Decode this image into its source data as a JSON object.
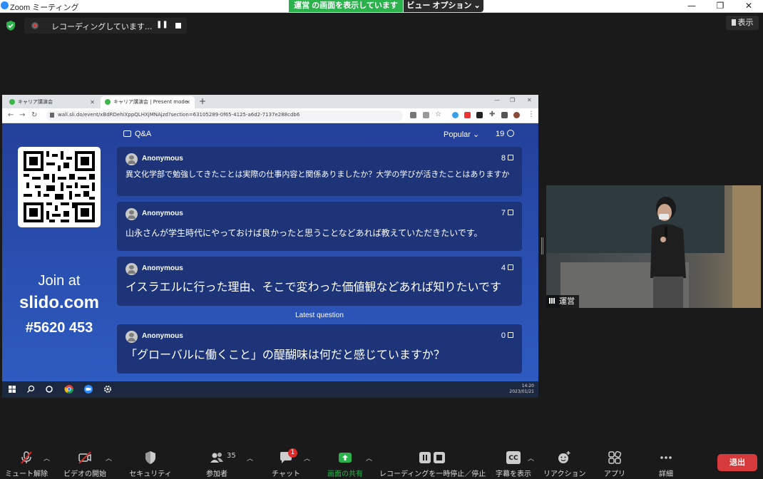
{
  "window": {
    "title": "Zoom ミーティング",
    "share_banner": "運営 の画面を表示しています",
    "view_options": "ビュー オプション ⌄",
    "minimize": "—",
    "maximize": "❐",
    "close": "✕"
  },
  "recording": {
    "status": "レコーディングしています...",
    "pause": "❚❚"
  },
  "view_button": "表示",
  "browser": {
    "tabs": [
      {
        "label": "キャリア講演会"
      },
      {
        "label": "キャリア講演会 | Present mode"
      }
    ],
    "url": "wall.sli.do/event/xBdRDehiXppQLHXjMNAjzd?section=63105289-0f65-4125-a6d2-7137e288cdb6"
  },
  "slido": {
    "join_at": "Join at",
    "domain": "slido.com",
    "code": "#5620 453",
    "header_label": "Q&A",
    "sort_label": "Popular ⌄",
    "question_count": "19",
    "latest_label": "Latest question",
    "questions": [
      {
        "author": "Anonymous",
        "votes": "8",
        "text": "異文化学部で勉強してきたことは実際の仕事内容と関係ありましたか？大学の学びが活きたことはありますか"
      },
      {
        "author": "Anonymous",
        "votes": "7",
        "text": "山永さんが学生時代にやっておけば良かったと思うことなどあれば教えていただきたいです。"
      },
      {
        "author": "Anonymous",
        "votes": "4",
        "text": "イスラエルに行った理由、そこで変わった価値観などあれば知りたいです"
      },
      {
        "author": "Anonymous",
        "votes": "0",
        "text": "「グローバルに働くこと」の醍醐味は何だと感じていますか？"
      }
    ]
  },
  "taskbar": {
    "time": "14:20",
    "date": "2023/01/21"
  },
  "video": {
    "participant_name": "運営"
  },
  "toolbar": {
    "mute": "ミュート解除",
    "video": "ビデオの開始",
    "security": "セキュリティ",
    "participants": "参加者",
    "participants_count": "35",
    "chat": "チャット",
    "chat_badge": "1",
    "share": "画面の共有",
    "recording": "レコーディングを一時停止／停止",
    "captions": "字幕を表示",
    "captions_icon_text": "CC",
    "reactions": "リアクション",
    "apps": "アプリ",
    "more": "詳細",
    "leave": "退出"
  },
  "colors": {
    "share_banner": "#2bb24c",
    "slido_bg": "#2a4fb0",
    "card_bg": "#1d3479",
    "leave": "#d63a3a",
    "share_icon": "#2bb24c"
  }
}
